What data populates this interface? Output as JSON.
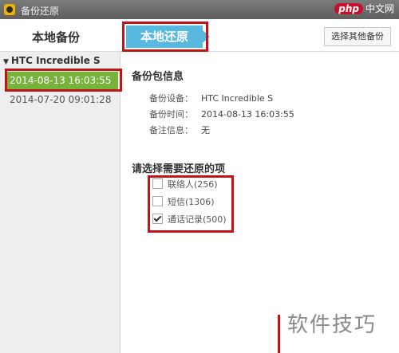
{
  "window": {
    "title": "备份还原"
  },
  "watermark_top": {
    "php": "php",
    "cn": "中文网"
  },
  "tabs": {
    "local_backup": "本地备份",
    "local_restore": "本地还原"
  },
  "toolbar": {
    "select_other": "选择其他备份"
  },
  "sidebar": {
    "device": "HTC Incredible S",
    "backups": [
      "2014-08-13 16:03:55",
      "2014-07-20 09:01:28"
    ]
  },
  "info": {
    "title": "备份包信息",
    "rows": [
      {
        "label": "备份设备：",
        "value": "HTC Incredible S"
      },
      {
        "label": "备份时间：",
        "value": "2014-08-13 16:03:55"
      },
      {
        "label": "备注信息：",
        "value": "无"
      }
    ]
  },
  "restore": {
    "title": "请选择需要还原的项",
    "options": [
      {
        "label": "联络人(256)",
        "checked": false
      },
      {
        "label": "短信(1306)",
        "checked": false
      },
      {
        "label": "通话记录(500)",
        "checked": true
      }
    ]
  },
  "watermark_bottom": "软件技巧",
  "colors": {
    "tab_active": "#58b8de",
    "selected_item": "#77b33a",
    "highlight": "#c0151b"
  }
}
